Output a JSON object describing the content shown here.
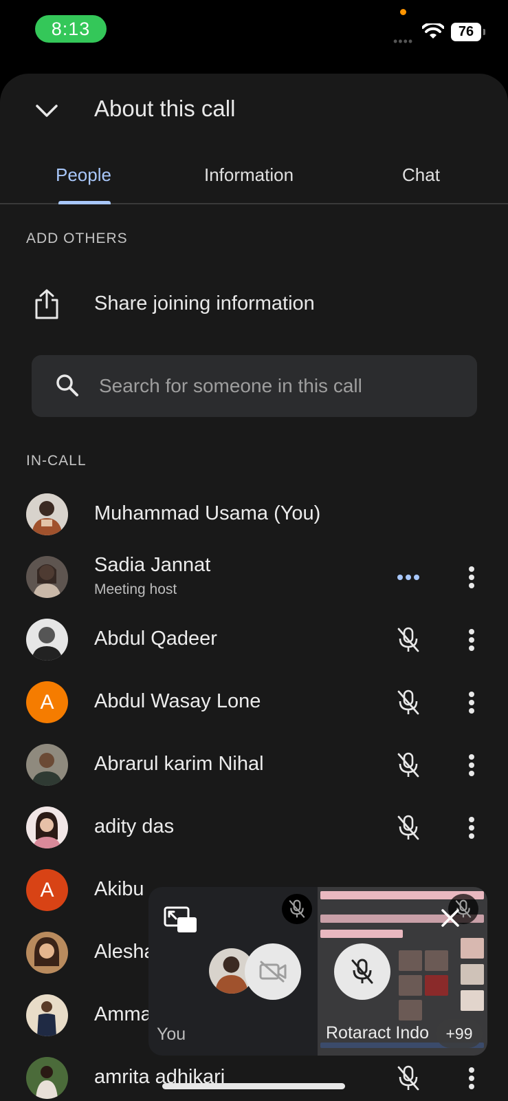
{
  "status_bar": {
    "time": "8:13",
    "battery": "76",
    "accent": "#34c759"
  },
  "header": {
    "title": "About this call",
    "collapse_icon": "chevron-down-icon"
  },
  "tabs": [
    {
      "label": "People",
      "active": true
    },
    {
      "label": "Information",
      "active": false
    },
    {
      "label": "Chat",
      "active": false
    }
  ],
  "add_others": {
    "label": "ADD OTHERS",
    "share_label": "Share joining information"
  },
  "search": {
    "placeholder": "Search for someone in this call"
  },
  "in_call": {
    "label": "IN-CALL",
    "participants": [
      {
        "name": "Muhammad Usama (You)",
        "subtitle": "",
        "avatar": "photo",
        "status": "none"
      },
      {
        "name": "Sadia Jannat",
        "subtitle": "Meeting host",
        "avatar": "photo",
        "status": "speaking"
      },
      {
        "name": "Abdul Qadeer",
        "subtitle": "",
        "avatar": "photo",
        "status": "muted"
      },
      {
        "name": "Abdul Wasay Lone",
        "subtitle": "",
        "avatar": "A",
        "avatar_color": "#f57c00",
        "status": "muted"
      },
      {
        "name": "Abrarul karim Nihal",
        "subtitle": "",
        "avatar": "photo",
        "status": "muted"
      },
      {
        "name": "adity das",
        "subtitle": "",
        "avatar": "photo",
        "status": "muted"
      },
      {
        "name": "Akibu",
        "subtitle": "",
        "avatar": "A",
        "avatar_color": "#d84315",
        "status": "muted"
      },
      {
        "name": "Alesha",
        "subtitle": "",
        "avatar": "photo",
        "status": "muted"
      },
      {
        "name": "Amma",
        "subtitle": "",
        "avatar": "photo",
        "status": "muted"
      },
      {
        "name": "amrita adhikari",
        "subtitle": "",
        "avatar": "photo",
        "status": "muted"
      }
    ]
  },
  "pip": {
    "you_label": "You",
    "room_label": "Rotaract Indo",
    "count": "+99"
  }
}
